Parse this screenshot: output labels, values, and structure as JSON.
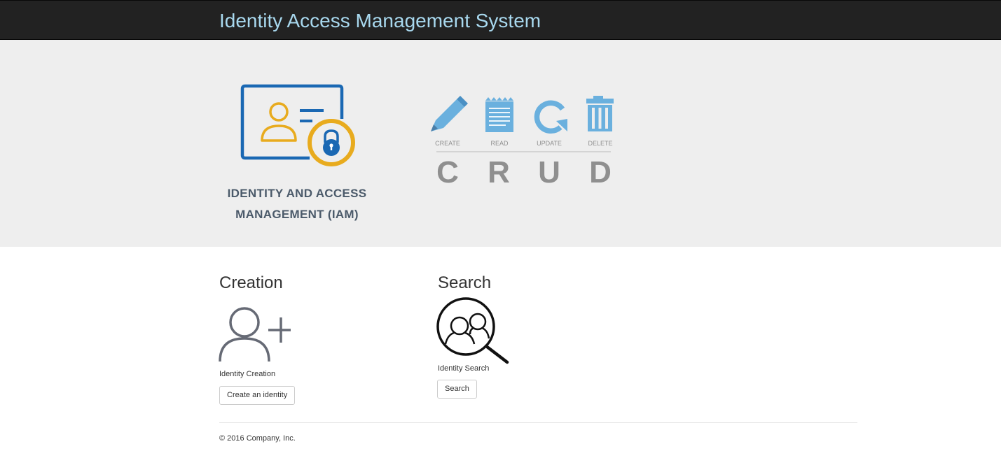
{
  "navbar": {
    "brand": "Identity Access Management System"
  },
  "jumbotron": {
    "iam_caption_line1": "IDENTITY AND ACCESS",
    "iam_caption_line2": "MANAGEMENT (IAM)",
    "crud": {
      "actions": [
        "CREATE",
        "READ",
        "UPDATE",
        "DELETE"
      ],
      "letters": [
        "C",
        "R",
        "U",
        "D"
      ]
    }
  },
  "creation": {
    "title": "Creation",
    "caption": "Identity Creation",
    "button_label": "Create an identity",
    "icon": "add-user-icon"
  },
  "search": {
    "title": "Search",
    "caption": "Identity Search",
    "button_label": "Search",
    "icon": "user-search-icon"
  },
  "footer": {
    "copyright": "© 2016 Company, Inc."
  },
  "colors": {
    "navbar_bg": "#222222",
    "brand_text": "#a8d8ee",
    "jumbotron_bg": "#eeeeee",
    "logo_blue": "#1a68b3",
    "logo_gold": "#e8ab1e",
    "crud_blue": "#6ab0de",
    "crud_gray": "#8f8f8f"
  }
}
